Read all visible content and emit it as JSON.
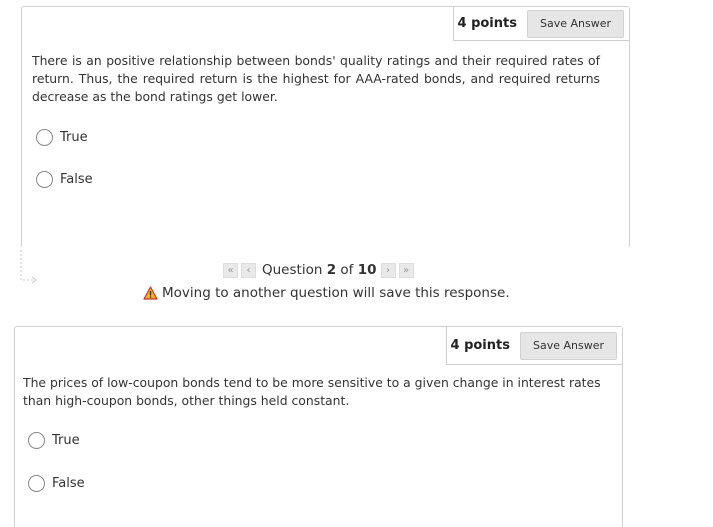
{
  "questions": [
    {
      "points": "4 points",
      "save_label": "Save Answer",
      "text": "There is an positive relationship between bonds' quality ratings and their required rates of return. Thus, the required return is the highest for AAA-rated bonds, and required returns decrease as the bond ratings get lower.",
      "options": [
        "True",
        "False"
      ]
    },
    {
      "points": "4 points",
      "save_label": "Save Answer",
      "text": "The prices of low-coupon bonds tend to be more sensitive to a given change in interest rates than high-coupon bonds, other things held constant.",
      "options": [
        "True",
        "False"
      ]
    }
  ],
  "navigation": {
    "first_glyph": "«",
    "prev_glyph": "‹",
    "next_glyph": "›",
    "last_glyph": "»",
    "label_prefix": "Question",
    "current": "2",
    "label_of": "of",
    "total": "10",
    "warning": "Moving to another question will save this response."
  },
  "icons": {
    "warning": "warning-triangle-icon",
    "nav": "navigation-arrow-icon"
  },
  "colors": {
    "warning_fill": "#f0b323",
    "border": "#cfcfcf",
    "button_bg": "#e6e6e6"
  }
}
